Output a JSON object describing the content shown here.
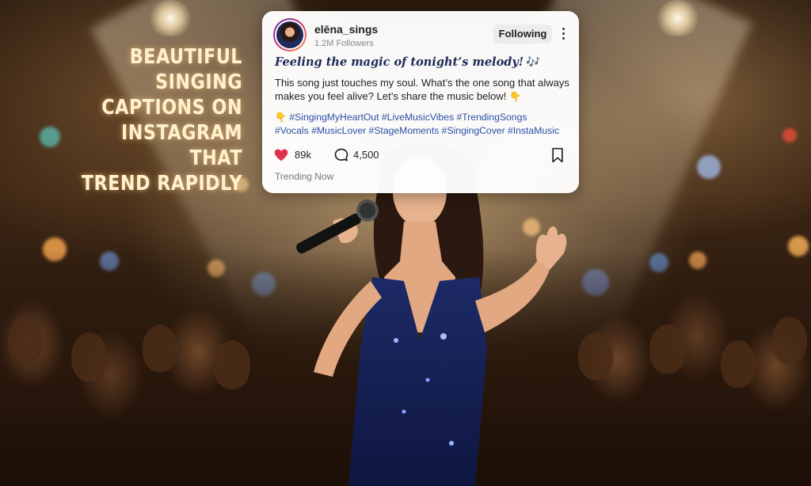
{
  "headline": {
    "lines": [
      "BEAUTIFUL SINGING",
      "CAPTIONS ON",
      "INSTAGRAM THAT",
      "TREND RAPIDLY"
    ]
  },
  "post": {
    "username": "elēna_sings",
    "followers": "1.2M Followers",
    "follow_label": "Following",
    "caption_title": "Feeling the magic of tonight’s melody!",
    "caption_title_icon": "🎶",
    "caption_body": "This song just touches my soul. What’s the one song that always makes you feel alive? Let’s share the music below!",
    "caption_body_icon": "👇",
    "hashtag_icon": "👇",
    "hashtags_line1": "#SingingMyHeartOut #LiveMusicVibes #TrendingSongs",
    "hashtags_line2": "#Vocals #MusicLover #StageMoments #SingingCover #InstaMusic",
    "likes": "89k",
    "comments": "4,500",
    "status": "Trending Now"
  },
  "icons": {
    "heart": "heart-icon",
    "comment": "comment-icon",
    "bookmark": "bookmark-icon",
    "more": "more-options-icon"
  },
  "colors": {
    "heart": "#e0314c",
    "hashtags": "#2a4fa6",
    "caption_title": "#1b2a55",
    "headline": "#fff1cf"
  }
}
